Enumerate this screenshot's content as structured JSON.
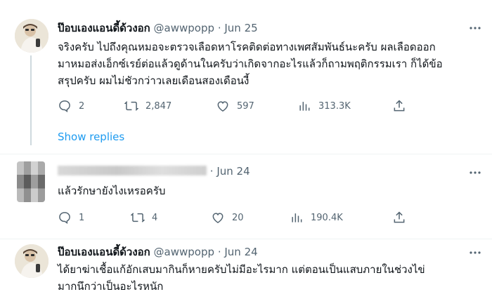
{
  "tweets": [
    {
      "name": "ป๊อบเองแอนดี้ด้วงอก",
      "handle": "@awwpopp",
      "separator": "·",
      "date": "Jun 25",
      "text": "จริงครับ ไปถึงคุณหมอจะตรวจเลือดหาโรคติดต่อทางเพศสัมพันธ์นะครับ ผลเลือดออก\nมาหมอส่งเอ็กซ์เรย์ต่อแล้วดูด้านในครับว่าเกิดจากอะไรแล้วก็ถามพฤติกรรมเรา ก็ได้ข้อ\nสรุปครับ ผมไม่ชัวกว่าวเลยเดือนสองเดือนงี้",
      "replies": "2",
      "retweets": "2,847",
      "likes": "597",
      "views": "313.3K",
      "more_icon": "more-icon"
    },
    {
      "name": "",
      "handle": "",
      "separator": "·",
      "date": "Jun 24",
      "text": "แล้วรักษายังไงเหรอครับ",
      "replies": "1",
      "retweets": "4",
      "likes": "20",
      "views": "190.4K"
    },
    {
      "name": "ป๊อบเองแอนดี้ด้วงอก",
      "handle": "@awwpopp",
      "separator": "·",
      "date": "Jun 24",
      "text": "ได้ยาฆ่าเชื้อแก้อักเสบมากินก็หายครับไม่มีอะไรมาก แต่ตอนเป็นแสบภายในช่วงไข่\nมากนึกว่าเป็นอะไรหนัก"
    }
  ],
  "show_replies": "Show replies",
  "colors": {
    "accent": "#1d9bf0",
    "muted": "#536471",
    "text": "#0f1419",
    "line": "#cfd9de"
  }
}
